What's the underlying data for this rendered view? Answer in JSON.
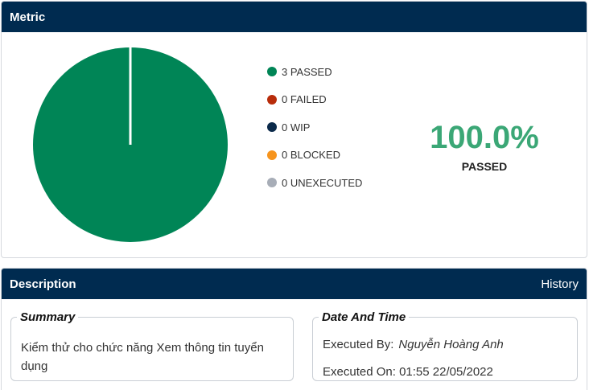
{
  "metric": {
    "header_title": "Metric",
    "legend": [
      {
        "label": "3 PASSED",
        "color": "#008556"
      },
      {
        "label": "0 FAILED",
        "color": "#b82c0a"
      },
      {
        "label": "0 WIP",
        "color": "#0b2a4a"
      },
      {
        "label": "0 BLOCKED",
        "color": "#f6941d"
      },
      {
        "label": "0 UNEXECUTED",
        "color": "#a7adb7"
      }
    ],
    "percent": "100.0%",
    "percent_label": "PASSED",
    "percent_color": "#3ba776"
  },
  "chart_data": {
    "type": "pie",
    "categories": [
      "PASSED",
      "FAILED",
      "WIP",
      "BLOCKED",
      "UNEXECUTED"
    ],
    "values": [
      3,
      0,
      0,
      0,
      0
    ],
    "colors": [
      "#008556",
      "#b82c0a",
      "#0b2a4a",
      "#f6941d",
      "#a7adb7"
    ]
  },
  "description": {
    "header_title": "Description",
    "history_link": "History",
    "summary_legend": "Summary",
    "summary_text": "Kiểm thử cho chức năng Xem thông tin tuyển dụng",
    "datetime_legend": "Date And Time",
    "executed_by_label": "Executed By:",
    "executed_by_value": "Nguyễn Hoàng Anh",
    "executed_on_label": "Executed On:",
    "executed_on_value": "01:55 22/05/2022"
  },
  "colors": {
    "header_bg": "#002b50",
    "header_text": "#ffffff"
  }
}
